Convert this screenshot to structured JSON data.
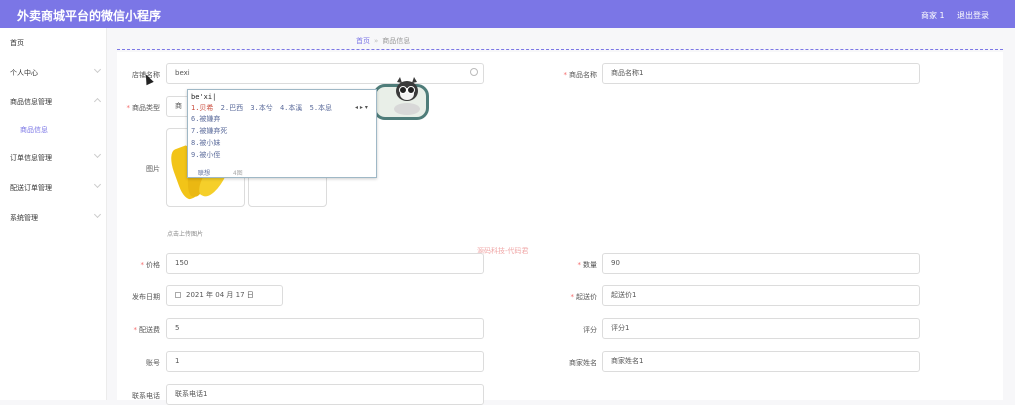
{
  "header": {
    "title": "外卖商城平台的微信小程序",
    "user": "商家 1",
    "logout": "退出登录"
  },
  "sidebar": {
    "items": [
      {
        "label": "首页"
      },
      {
        "label": "个人中心"
      },
      {
        "label": "商品信息管理"
      },
      {
        "label": "商品信息"
      },
      {
        "label": "订单信息管理"
      },
      {
        "label": "配送订单管理"
      },
      {
        "label": "系统管理"
      }
    ]
  },
  "breadcrumb": {
    "home": "首页",
    "sep": "»",
    "current": "商品信息"
  },
  "form": {
    "shop_name": {
      "label": "店铺名称",
      "value": "bexi"
    },
    "product_name": {
      "label": "商品名称",
      "value": "商品名称1"
    },
    "product_type": {
      "label": "商品类型",
      "value": "商"
    },
    "image": {
      "label": "图片",
      "hint": "点击上传图片"
    },
    "price": {
      "label": "价格",
      "value": "150"
    },
    "quantity": {
      "label": "数量",
      "value": "90"
    },
    "publish_date": {
      "label": "发布日期",
      "value": "2021 年 04 月 17 日"
    },
    "min_price": {
      "label": "起送价",
      "value": "起送价1"
    },
    "delivery_fee": {
      "label": "配送费",
      "value": "5"
    },
    "rating": {
      "label": "评分",
      "value": "评分1"
    },
    "account": {
      "label": "账号",
      "value": "1"
    },
    "merchant_name": {
      "label": "商家姓名",
      "value": "商家姓名1"
    },
    "phone": {
      "label": "联系电话",
      "value": "联系电话1"
    }
  },
  "watermark": "源码科技-代码君",
  "ime": {
    "pinyin": "be'xi|",
    "first_row": [
      "1.贝希",
      "2.巴西",
      "3.本兮",
      "4.本溪",
      "5.本息"
    ],
    "candidates": [
      "6.被嫌弃",
      "7.被嫌弃死",
      "8.被小妹",
      "9.被小侄"
    ],
    "footer": "联想",
    "footer2": "4图",
    "arrows": "◂ ▸ ▾"
  },
  "colors": {
    "accent": "#7b76e6",
    "required": "#f56c6c"
  }
}
